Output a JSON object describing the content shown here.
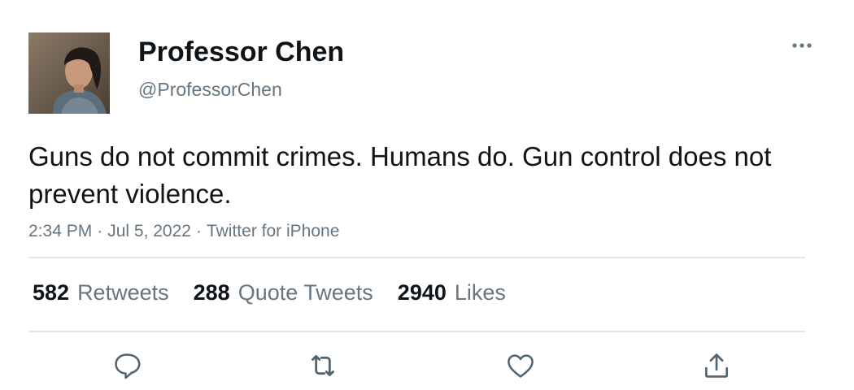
{
  "user": {
    "display_name": "Professor Chen",
    "handle": "@ProfessorChen",
    "avatar_icon": "profile-photo"
  },
  "tweet": {
    "text": "Guns do not commit crimes. Humans do. Gun control does not prevent violence.",
    "time": "2:34 PM",
    "date": "Jul 5, 2022",
    "source": "Twitter for iPhone",
    "separator": "·"
  },
  "stats": {
    "retweets_count": "582",
    "retweets_label": "Retweets",
    "quotes_count": "288",
    "quotes_label": "Quote Tweets",
    "likes_count": "2940",
    "likes_label": "Likes"
  },
  "actions": {
    "reply_icon": "reply-icon",
    "retweet_icon": "retweet-icon",
    "like_icon": "heart-icon",
    "share_icon": "share-icon",
    "more_icon": "more-icon"
  },
  "colors": {
    "text_primary": "#0f1419",
    "text_secondary": "#66757f",
    "divider": "#e1e6ea",
    "icon": "#536471"
  }
}
